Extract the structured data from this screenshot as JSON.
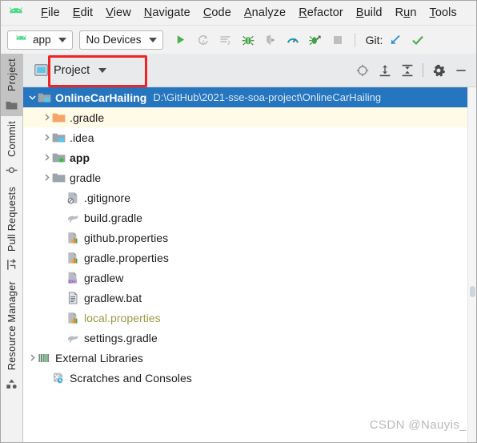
{
  "app": {
    "logo_icon": "android-logo-icon",
    "watermark": "CSDN @Nauyis_"
  },
  "menubar": {
    "items": [
      {
        "label": "File",
        "accel": "F"
      },
      {
        "label": "Edit",
        "accel": "E"
      },
      {
        "label": "View",
        "accel": "V"
      },
      {
        "label": "Navigate",
        "accel": "N"
      },
      {
        "label": "Code",
        "accel": "C"
      },
      {
        "label": "Analyze",
        "accel": "A"
      },
      {
        "label": "Refactor",
        "accel": "R"
      },
      {
        "label": "Build",
        "accel": "B"
      },
      {
        "label": "Run",
        "accel": "u"
      },
      {
        "label": "Tools",
        "accel": "T"
      }
    ]
  },
  "toolbar": {
    "module_selector": {
      "label": "app",
      "icon": "android-logo-icon"
    },
    "device_selector": {
      "label": "No Devices"
    },
    "buttons": [
      {
        "name": "run-button",
        "icon": "play-icon",
        "enabled": true
      },
      {
        "name": "apply-changes-button",
        "icon": "apply-changes-icon",
        "enabled": false
      },
      {
        "name": "apply-code-changes-button",
        "icon": "apply-code-changes-icon",
        "enabled": false
      },
      {
        "name": "debug-button",
        "icon": "bug-icon",
        "enabled": true
      },
      {
        "name": "attach-debugger-button",
        "icon": "attach-debugger-icon",
        "enabled": false
      },
      {
        "name": "profiler-button",
        "icon": "profiler-icon",
        "enabled": true
      },
      {
        "name": "run-with-coverage-button",
        "icon": "coverage-icon",
        "enabled": true
      },
      {
        "name": "stop-button",
        "icon": "stop-square-icon",
        "enabled": false
      }
    ],
    "git_label": "Git:",
    "git_buttons": [
      {
        "name": "update-project-button",
        "icon": "arrow-down-left-icon"
      },
      {
        "name": "commit-button",
        "icon": "check-icon"
      }
    ]
  },
  "toolwindows": [
    {
      "label": "Project",
      "icon": "project-folder-icon",
      "active": true
    },
    {
      "label": "Commit",
      "icon": "commit-icon",
      "active": false
    },
    {
      "label": "Pull Requests",
      "icon": "pull-request-icon",
      "active": false
    },
    {
      "label": "Resource Manager",
      "icon": "resource-manager-icon",
      "active": false
    }
  ],
  "panel": {
    "title": "Project",
    "title_icon": "project-view-icon",
    "dropdown_icon": "chevron-down-icon",
    "actions": [
      {
        "name": "select-opened-file-button",
        "icon": "locate-target-icon"
      },
      {
        "name": "expand-all-button",
        "icon": "expand-all-icon"
      },
      {
        "name": "collapse-all-button",
        "icon": "collapse-all-icon"
      },
      {
        "name": "settings-button",
        "icon": "gear-icon"
      },
      {
        "name": "hide-button",
        "icon": "minimize-icon"
      }
    ],
    "highlight_color": "#f02424"
  },
  "tree": {
    "rows": [
      {
        "label": "OnlineCarHailing",
        "path": "D:\\GitHub\\2021-sse-soa-project\\OnlineCarHailing",
        "indent": 0,
        "arrow": "down",
        "icon": "module-folder-icon",
        "bold": true,
        "state": "selected"
      },
      {
        "label": ".gradle",
        "indent": 1,
        "arrow": "right",
        "icon": "excluded-folder-icon",
        "state": "hovered"
      },
      {
        "label": ".idea",
        "indent": 1,
        "arrow": "right",
        "icon": "module-folder-icon",
        "state": "normal"
      },
      {
        "label": "app",
        "indent": 1,
        "arrow": "right",
        "icon": "source-folder-icon",
        "bold": true,
        "state": "normal"
      },
      {
        "label": "gradle",
        "indent": 1,
        "arrow": "right",
        "icon": "folder-icon",
        "state": "normal"
      },
      {
        "label": ".gitignore",
        "indent": 2,
        "arrow": "none",
        "icon": "gitignore-file-icon",
        "state": "normal"
      },
      {
        "label": "build.gradle",
        "indent": 2,
        "arrow": "none",
        "icon": "gradle-file-icon",
        "state": "normal"
      },
      {
        "label": "github.properties",
        "indent": 2,
        "arrow": "none",
        "icon": "properties-file-icon",
        "state": "normal"
      },
      {
        "label": "gradle.properties",
        "indent": 2,
        "arrow": "none",
        "icon": "properties-file-icon",
        "state": "normal"
      },
      {
        "label": "gradlew",
        "indent": 2,
        "arrow": "none",
        "icon": "cpp-file-icon",
        "state": "normal"
      },
      {
        "label": "gradlew.bat",
        "indent": 2,
        "arrow": "none",
        "icon": "text-file-icon",
        "state": "normal"
      },
      {
        "label": "local.properties",
        "indent": 2,
        "arrow": "none",
        "icon": "properties-file-icon",
        "state": "ignored"
      },
      {
        "label": "settings.gradle",
        "indent": 2,
        "arrow": "none",
        "icon": "gradle-file-icon",
        "state": "normal"
      },
      {
        "label": "External Libraries",
        "indent": 0,
        "arrow": "right",
        "icon": "libraries-icon",
        "state": "normal"
      },
      {
        "label": "Scratches and Consoles",
        "indent": 1,
        "arrow": "none",
        "icon": "scratches-icon",
        "state": "normal"
      }
    ]
  }
}
